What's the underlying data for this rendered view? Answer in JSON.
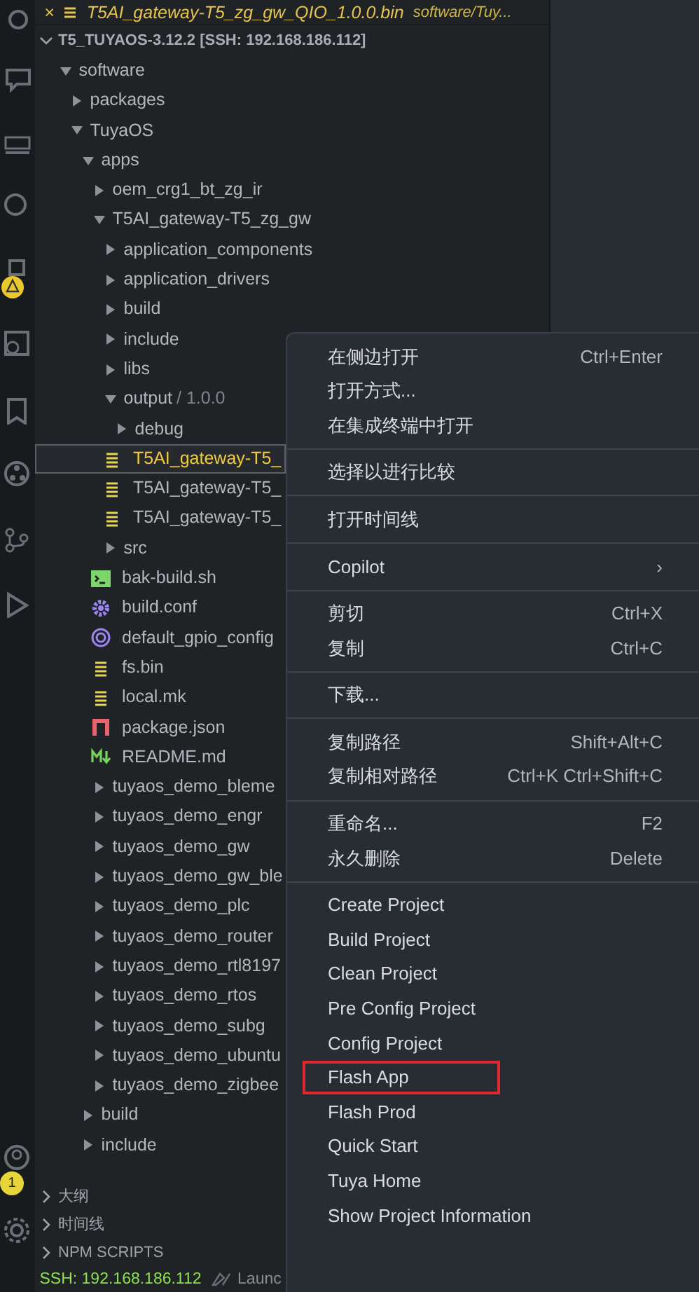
{
  "editor_tab": {
    "title": "T5AI_gateway-T5_zg_gw_QIO_1.0.0.bin",
    "path": "software/Tuy...",
    "close": "×"
  },
  "activity_bar": {
    "account_badge": "1"
  },
  "explorer": {
    "root": "T5_TUYAOS-3.12.2 [SSH: 192.168.186.112]",
    "expanded": true,
    "tree": [
      {
        "label": "software",
        "kind": "folder",
        "expanded": true,
        "selected": false,
        "children": [
          {
            "label": "packages",
            "kind": "folder",
            "expanded": false,
            "selected": false
          },
          {
            "label": "TuyaOS",
            "kind": "folder",
            "expanded": true,
            "selected": false,
            "children": [
              {
                "label": "apps",
                "kind": "folder",
                "expanded": true,
                "selected": false,
                "children": [
                  {
                    "label": "oem_crg1_bt_zg_ir",
                    "kind": "folder",
                    "expanded": false,
                    "selected": false
                  },
                  {
                    "label": "T5AI_gateway-T5_zg_gw",
                    "kind": "folder",
                    "expanded": true,
                    "selected": false,
                    "children": [
                      {
                        "label": "application_components",
                        "kind": "folder",
                        "expanded": false,
                        "selected": false
                      },
                      {
                        "label": "application_drivers",
                        "kind": "folder",
                        "expanded": false,
                        "selected": false
                      },
                      {
                        "label": "build",
                        "kind": "folder",
                        "expanded": false,
                        "selected": false
                      },
                      {
                        "label": "include",
                        "kind": "folder",
                        "expanded": false,
                        "selected": false
                      },
                      {
                        "label": "libs",
                        "kind": "folder",
                        "expanded": false,
                        "selected": false
                      },
                      {
                        "label": "output",
                        "suffix": "/ 1.0.0",
                        "kind": "folder",
                        "expanded": true,
                        "selected": false,
                        "children": [
                          {
                            "label": "debug",
                            "kind": "folder",
                            "expanded": false,
                            "selected": false
                          },
                          {
                            "label": "T5AI_gateway-T5_",
                            "kind": "binary",
                            "selected": true
                          },
                          {
                            "label": "T5AI_gateway-T5_",
                            "kind": "binary",
                            "selected": false
                          },
                          {
                            "label": "T5AI_gateway-T5_",
                            "kind": "binary",
                            "selected": false
                          }
                        ]
                      },
                      {
                        "label": "src",
                        "kind": "folder",
                        "expanded": false,
                        "selected": false
                      },
                      {
                        "label": "bak-build.sh",
                        "kind": "shell",
                        "selected": false
                      },
                      {
                        "label": "build.conf",
                        "kind": "gear",
                        "selected": false
                      },
                      {
                        "label": "default_gpio_config",
                        "kind": "ring",
                        "selected": false
                      },
                      {
                        "label": "fs.bin",
                        "kind": "binary",
                        "selected": false
                      },
                      {
                        "label": "local.mk",
                        "kind": "binary",
                        "selected": false
                      },
                      {
                        "label": "package.json",
                        "kind": "package",
                        "selected": false
                      },
                      {
                        "label": "README.md",
                        "kind": "markdown",
                        "selected": false
                      }
                    ]
                  },
                  {
                    "label": "tuyaos_demo_bleme",
                    "kind": "folder",
                    "expanded": false,
                    "selected": false
                  },
                  {
                    "label": "tuyaos_demo_engr",
                    "kind": "folder",
                    "expanded": false,
                    "selected": false
                  },
                  {
                    "label": "tuyaos_demo_gw",
                    "kind": "folder",
                    "expanded": false,
                    "selected": false
                  },
                  {
                    "label": "tuyaos_demo_gw_ble",
                    "kind": "folder",
                    "expanded": false,
                    "selected": false
                  },
                  {
                    "label": "tuyaos_demo_plc",
                    "kind": "folder",
                    "expanded": false,
                    "selected": false
                  },
                  {
                    "label": "tuyaos_demo_router",
                    "kind": "folder",
                    "expanded": false,
                    "selected": false
                  },
                  {
                    "label": "tuyaos_demo_rtl8197",
                    "kind": "folder",
                    "expanded": false,
                    "selected": false
                  },
                  {
                    "label": "tuyaos_demo_rtos",
                    "kind": "folder",
                    "expanded": false,
                    "selected": false
                  },
                  {
                    "label": "tuyaos_demo_subg",
                    "kind": "folder",
                    "expanded": false,
                    "selected": false
                  },
                  {
                    "label": "tuyaos_demo_ubuntu",
                    "kind": "folder",
                    "expanded": false,
                    "selected": false
                  },
                  {
                    "label": "tuyaos_demo_zigbee",
                    "kind": "folder",
                    "expanded": false,
                    "selected": false
                  }
                ]
              },
              {
                "label": "build",
                "kind": "folder",
                "expanded": false,
                "selected": false
              },
              {
                "label": "include",
                "kind": "folder",
                "expanded": false,
                "selected": false
              }
            ]
          }
        ]
      }
    ]
  },
  "sections": [
    {
      "label": "大纲",
      "expanded": false
    },
    {
      "label": "时间线",
      "expanded": false
    },
    {
      "label": "NPM SCRIPTS",
      "expanded": false
    }
  ],
  "status_bar": {
    "remote": "SSH: 192.168.186.112",
    "launch": "Launc"
  },
  "context_menu": [
    {
      "kind": "item",
      "label": "在侧边打开",
      "shortcut": "Ctrl+Enter",
      "highlighted": false
    },
    {
      "kind": "item",
      "label": "打开方式...",
      "highlighted": false
    },
    {
      "kind": "item",
      "label": "在集成终端中打开",
      "highlighted": false
    },
    {
      "kind": "separator"
    },
    {
      "kind": "item",
      "label": "选择以进行比较",
      "highlighted": false
    },
    {
      "kind": "separator"
    },
    {
      "kind": "item",
      "label": "打开时间线",
      "highlighted": false
    },
    {
      "kind": "separator"
    },
    {
      "kind": "submenu",
      "label": "Copilot",
      "arrow": "›",
      "highlighted": false
    },
    {
      "kind": "separator"
    },
    {
      "kind": "item",
      "label": "剪切",
      "shortcut": "Ctrl+X",
      "highlighted": false
    },
    {
      "kind": "item",
      "label": "复制",
      "shortcut": "Ctrl+C",
      "highlighted": false
    },
    {
      "kind": "separator"
    },
    {
      "kind": "item",
      "label": "下载...",
      "highlighted": false
    },
    {
      "kind": "separator"
    },
    {
      "kind": "item",
      "label": "复制路径",
      "shortcut": "Shift+Alt+C",
      "highlighted": false
    },
    {
      "kind": "item",
      "label": "复制相对路径",
      "shortcut": "Ctrl+K Ctrl+Shift+C",
      "highlighted": false
    },
    {
      "kind": "separator"
    },
    {
      "kind": "item",
      "label": "重命名...",
      "shortcut": "F2",
      "highlighted": false
    },
    {
      "kind": "item",
      "label": "永久删除",
      "shortcut": "Delete",
      "highlighted": false
    },
    {
      "kind": "separator"
    },
    {
      "kind": "item",
      "label": "Create Project",
      "highlighted": false
    },
    {
      "kind": "item",
      "label": "Build Project",
      "highlighted": false
    },
    {
      "kind": "item",
      "label": "Clean Project",
      "highlighted": false
    },
    {
      "kind": "item",
      "label": "Pre Config Project",
      "highlighted": false
    },
    {
      "kind": "item",
      "label": "Config Project",
      "highlighted": false
    },
    {
      "kind": "item",
      "label": "Flash App",
      "highlighted": true
    },
    {
      "kind": "item",
      "label": "Flash Prod",
      "highlighted": false
    },
    {
      "kind": "item",
      "label": "Quick Start",
      "highlighted": false
    },
    {
      "kind": "item",
      "label": "Tuya Home",
      "highlighted": false
    },
    {
      "kind": "item",
      "label": "Show Project Information",
      "highlighted": false
    }
  ]
}
